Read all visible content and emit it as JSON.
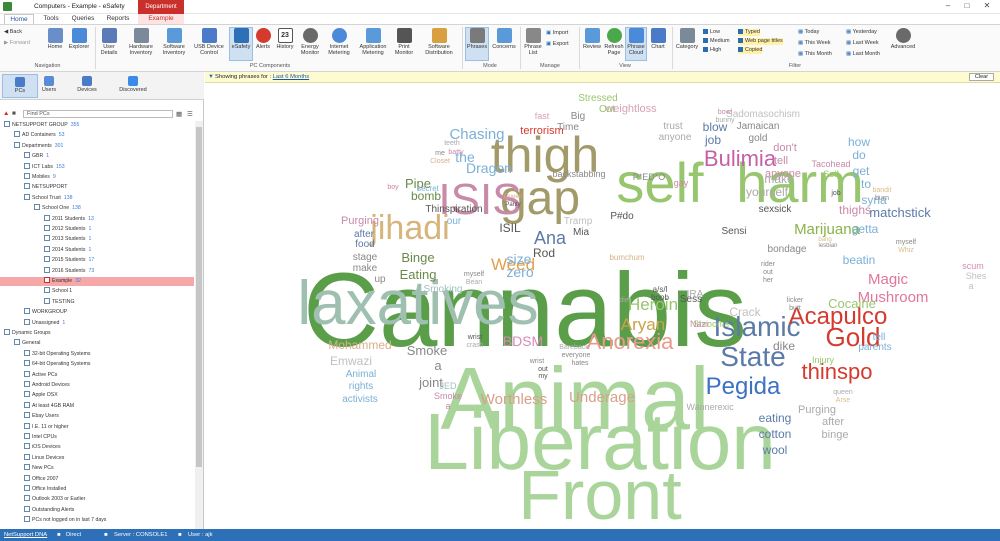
{
  "window": {
    "title": "Computers - Example - eSafety",
    "context_tab": "Department"
  },
  "tabs": [
    "Home",
    "Tools",
    "Queries",
    "Reports",
    "Example"
  ],
  "ribbon": {
    "back": "Back",
    "forward": "Forward",
    "home": "Home",
    "explorer": "Explorer",
    "user_details": "User Details",
    "hardware_inventory": "Hardware Inventory",
    "software_inventory": "Software Inventory",
    "usb_device_control": "USB Device Control",
    "esafety": "eSafety",
    "alerts": "Alerts",
    "history": "History",
    "energy_monitor": "Energy Monitor",
    "internet_metering": "Internet Metering",
    "application_metering": "Application Metering",
    "print_monitor": "Print Monitor",
    "software_distribution": "Software Distribution",
    "phrases": "Phrases",
    "concerns": "Concerns",
    "phrase_list": "Phrase List",
    "import": "Import",
    "export": "Export",
    "review": "Review",
    "refresh_page": "Refresh Page",
    "phrase_cloud": "Phrase Cloud",
    "chart": "Chart",
    "category": "Category",
    "low": "Low",
    "medium": "Medium",
    "high": "High",
    "typed": "Typed",
    "web_page_titles": "Web page titles",
    "copied": "Copied",
    "today": "Today",
    "this_week": "This Week",
    "this_month": "This Month",
    "yesterday": "Yesterday",
    "last_week": "Last Week",
    "last_month": "Last Month",
    "advanced": "Advanced",
    "groups": {
      "navigation": "Navigation",
      "pc_components": "PC Components",
      "mode": "Mode",
      "manage": "Manage",
      "view": "View",
      "filter": "Filter"
    },
    "history_day": "23",
    "colors": {
      "ribbon_selected": "#cfe0f2",
      "accent": "#2e70b8",
      "context": "#c9302c"
    }
  },
  "mode_tabs": [
    "PCs",
    "Users",
    "Devices",
    "Discovered"
  ],
  "search": {
    "placeholder": "Find PCs"
  },
  "tree": [
    {
      "label": "NETSUPPORT GROUP",
      "count": "355",
      "indent": 0
    },
    {
      "label": "AD Containers",
      "count": "53",
      "indent": 1
    },
    {
      "label": "Departments",
      "count": "301",
      "indent": 1
    },
    {
      "label": "GBR",
      "count": "1",
      "indent": 2
    },
    {
      "label": "ICT Labs",
      "count": "153",
      "indent": 2
    },
    {
      "label": "Mobiles",
      "count": "9",
      "indent": 2
    },
    {
      "label": "NETSUPPORT",
      "count": "",
      "indent": 2
    },
    {
      "label": "School Trust",
      "count": "138",
      "indent": 2
    },
    {
      "label": "School One",
      "count": "138",
      "indent": 3
    },
    {
      "label": "2011 Students",
      "count": "13",
      "indent": 4
    },
    {
      "label": "2012 Students",
      "count": "1",
      "indent": 4
    },
    {
      "label": "2013 Students",
      "count": "1",
      "indent": 4
    },
    {
      "label": "2014 Students",
      "count": "1",
      "indent": 4
    },
    {
      "label": "2015 Students",
      "count": "17",
      "indent": 4
    },
    {
      "label": "2016 Students",
      "count": "73",
      "indent": 4
    },
    {
      "label": "Example",
      "count": "32",
      "indent": 4,
      "selected": true
    },
    {
      "label": "School 1",
      "count": "",
      "indent": 4
    },
    {
      "label": "TESTING",
      "count": "",
      "indent": 4
    },
    {
      "label": "WORKGROUP",
      "count": "",
      "indent": 2
    },
    {
      "label": "Unassigned",
      "count": "1",
      "indent": 2
    },
    {
      "label": "Dynamic Groups",
      "count": "",
      "indent": 0
    },
    {
      "label": "General",
      "count": "",
      "indent": 1
    },
    {
      "label": "32-bit Operating Systems",
      "count": "",
      "indent": 2
    },
    {
      "label": "64-bit Operating Systems",
      "count": "",
      "indent": 2
    },
    {
      "label": "Active PCs",
      "count": "",
      "indent": 2
    },
    {
      "label": "Android Devices",
      "count": "",
      "indent": 2
    },
    {
      "label": "Apple OSX",
      "count": "",
      "indent": 2
    },
    {
      "label": "At least 4GB RAM",
      "count": "",
      "indent": 2
    },
    {
      "label": "Ebay Users",
      "count": "",
      "indent": 2
    },
    {
      "label": "I.E. 11 or higher",
      "count": "",
      "indent": 2
    },
    {
      "label": "Intel CPUs",
      "count": "",
      "indent": 2
    },
    {
      "label": "iOS Devices",
      "count": "",
      "indent": 2
    },
    {
      "label": "Linux Devices",
      "count": "",
      "indent": 2
    },
    {
      "label": "New PCs",
      "count": "",
      "indent": 2
    },
    {
      "label": "Office 2007",
      "count": "",
      "indent": 2
    },
    {
      "label": "Office Installed",
      "count": "",
      "indent": 2
    },
    {
      "label": "Outlook 2003 or Earlier",
      "count": "",
      "indent": 2
    },
    {
      "label": "Outstanding Alerts",
      "count": "",
      "indent": 2
    },
    {
      "label": "PCs not logged on in last 7 days",
      "count": "",
      "indent": 2
    }
  ],
  "filterbar": {
    "prefix": "Showing phrases for :",
    "period": "Last 6 Months",
    "clear": "Clear"
  },
  "cloud": [
    {
      "t": "Cannabis",
      "c": "#5a9e4a"
    },
    {
      "t": "Animal",
      "c": "#a9d49a"
    },
    {
      "t": "Liberation",
      "c": "#a9d49a"
    },
    {
      "t": "Front",
      "c": "#a9d49a"
    },
    {
      "t": "laxatives",
      "c": "#9fc0b0"
    },
    {
      "t": "self",
      "c": "#98c66e"
    },
    {
      "t": "harm",
      "c": "#98c66e"
    },
    {
      "t": "thigh",
      "c": "#a39a6a"
    },
    {
      "t": "gap",
      "c": "#a39a6a"
    },
    {
      "t": "ISIS",
      "c": "#c88aa8"
    },
    {
      "t": "jihadi",
      "c": "#d7b47a"
    },
    {
      "t": "Bulimia",
      "c": "#c55fa8"
    },
    {
      "t": "Islamic",
      "c": "#5c7aa8"
    },
    {
      "t": "State",
      "c": "#5c7aa8"
    },
    {
      "t": "Acapulco",
      "c": "#d53a2e"
    },
    {
      "t": "Gold",
      "c": "#d53a2e"
    },
    {
      "t": "Pegida",
      "c": "#3c72c4"
    },
    {
      "t": "thinspo",
      "c": "#d53a2e"
    },
    {
      "t": "Anorexia",
      "c": "#e89a8a"
    },
    {
      "t": "Mushroom",
      "c": "#e0769a"
    },
    {
      "t": "Magic",
      "c": "#e0769a"
    },
    {
      "t": "Marijuana",
      "c": "#88b24a"
    },
    {
      "t": "Weed",
      "c": "#e0a050"
    },
    {
      "t": "Heroin",
      "c": "#98c66e"
    },
    {
      "t": "Aryan",
      "c": "#c9a24a"
    },
    {
      "t": "Worthless",
      "c": "#d8a088"
    },
    {
      "t": "Underage",
      "c": "#d8a088"
    },
    {
      "t": "Chasing",
      "c": "#7ab0d8"
    },
    {
      "t": "the",
      "c": "#7ab0d8"
    },
    {
      "t": "Dragon",
      "c": "#7ab0d8"
    },
    {
      "t": "Pipe",
      "c": "#6a8a4a"
    },
    {
      "t": "bomb",
      "c": "#6a8a4a"
    },
    {
      "t": "Binge",
      "c": "#6a8a4a"
    },
    {
      "t": "Eating",
      "c": "#6a8a4a"
    },
    {
      "t": "Mohammed",
      "c": "#d8b088"
    },
    {
      "t": "Emwazi",
      "c": "#c0c0c0"
    },
    {
      "t": "Smoke",
      "c": "#888"
    },
    {
      "t": "a",
      "c": "#888"
    },
    {
      "t": "joint",
      "c": "#888"
    },
    {
      "t": "BDSM",
      "c": "#d88ab8"
    },
    {
      "t": "Cocaine",
      "c": "#98c66e"
    },
    {
      "t": "Crack",
      "c": "#c0c0c0"
    },
    {
      "t": "dike",
      "c": "#888"
    },
    {
      "t": "matchstick",
      "c": "#5c7aa8"
    },
    {
      "t": "thighs",
      "c": "#c88aa8"
    },
    {
      "t": "getta",
      "c": "#7ab0d8"
    },
    {
      "t": "beatin",
      "c": "#7ab0d8"
    },
    {
      "t": "eating",
      "c": "#5c7aa8"
    },
    {
      "t": "cotton",
      "c": "#5c7aa8"
    },
    {
      "t": "wool",
      "c": "#5c7aa8"
    },
    {
      "t": "Purging",
      "c": "#aaa"
    },
    {
      "t": "after",
      "c": "#aaa"
    },
    {
      "t": "binge",
      "c": "#aaa"
    },
    {
      "t": "Purging",
      "c": "#c88aa8"
    },
    {
      "t": "after",
      "c": "#5c7aa8"
    },
    {
      "t": "food",
      "c": "#5c7aa8"
    },
    {
      "t": "stage",
      "c": "#888"
    },
    {
      "t": "make",
      "c": "#888"
    },
    {
      "t": "up",
      "c": "#888"
    },
    {
      "t": "Animal",
      "c": "#7ab0d8"
    },
    {
      "t": "rights",
      "c": "#7ab0d8"
    },
    {
      "t": "activists",
      "c": "#7ab0d8"
    },
    {
      "t": "Smoking",
      "c": "#a0c0c0"
    },
    {
      "t": "Ana",
      "c": "#5c7aa8"
    },
    {
      "t": "size",
      "c": "#7ab0d8"
    },
    {
      "t": "zero",
      "c": "#7ab0d8"
    },
    {
      "t": "Rod",
      "c": "#555"
    },
    {
      "t": "ISIL",
      "c": "#555"
    },
    {
      "t": "terrorism",
      "c": "#d53a2e"
    },
    {
      "t": "weightloss",
      "c": "#d8a0b8"
    },
    {
      "t": "yourself",
      "c": "#aaa"
    },
    {
      "t": "make",
      "c": "#aaa"
    },
    {
      "t": "sexsick",
      "c": "#555"
    },
    {
      "t": "bondage",
      "c": "#888"
    },
    {
      "t": "parents",
      "c": "#7ab0d8"
    },
    {
      "t": "tell",
      "c": "#7ab0d8"
    },
    {
      "t": "how",
      "c": "#7ab0d8"
    },
    {
      "t": "do",
      "c": "#7ab0d8"
    },
    {
      "t": "get",
      "c": "#7ab0d8"
    },
    {
      "t": "to",
      "c": "#7ab0d8"
    },
    {
      "t": "syria",
      "c": "#7ab0d8"
    },
    {
      "t": "don't",
      "c": "#c88aa8"
    },
    {
      "t": "tell",
      "c": "#c88aa8"
    },
    {
      "t": "anyone",
      "c": "#c88aa8"
    },
    {
      "t": "Sadomasochism",
      "c": "#c0c0c0"
    },
    {
      "t": "Jamaican",
      "c": "#888"
    },
    {
      "t": "gold",
      "c": "#888"
    },
    {
      "t": "blow",
      "c": "#5c7aa8"
    },
    {
      "t": "job",
      "c": "#5c7aa8"
    },
    {
      "t": "trust",
      "c": "#aaa"
    },
    {
      "t": "anyone",
      "c": "#aaa"
    },
    {
      "t": "Stressed",
      "c": "#98c66e"
    },
    {
      "t": "Out",
      "c": "#98c66e"
    },
    {
      "t": "Big",
      "c": "#888"
    },
    {
      "t": "Time",
      "c": "#888"
    },
    {
      "t": "fast",
      "c": "#d8a0b8"
    },
    {
      "t": "backstabbing",
      "c": "#888"
    },
    {
      "t": "P*ED*O",
      "c": "#888"
    },
    {
      "t": "gay",
      "c": "#c88aa8"
    },
    {
      "t": "Thinspiration",
      "c": "#555"
    },
    {
      "t": "our",
      "c": "#7ab0d8"
    },
    {
      "t": "secret",
      "c": "#7ab0d8"
    },
    {
      "t": "Wannerexic",
      "c": "#aaa"
    },
    {
      "t": "Tacohead",
      "c": "#c88aa8"
    },
    {
      "t": "Self",
      "c": "#98c66e"
    },
    {
      "t": "Injury",
      "c": "#98c66e"
    },
    {
      "t": "Shrooms",
      "c": "#98c66e"
    },
    {
      "t": "Nazi",
      "c": "#c88aa8"
    },
    {
      "t": "Sess",
      "c": "#555"
    },
    {
      "t": "IRA",
      "c": "#aaa"
    },
    {
      "t": "scum",
      "c": "#d88ab8"
    },
    {
      "t": "Shes",
      "c": "#c0c0c0"
    },
    {
      "t": "a",
      "c": "#c0c0c0"
    },
    {
      "t": "Tramp",
      "c": "#c0c0c0"
    },
    {
      "t": "Mia",
      "c": "#555"
    },
    {
      "t": "Sensi",
      "c": "#555"
    },
    {
      "t": "P#do",
      "c": "#555"
    },
    {
      "t": "JED",
      "c": "#a0c0c0"
    },
    {
      "t": "Smoke",
      "c": "#c88aa8"
    },
    {
      "t": "a",
      "c": "#c88aa8"
    },
    {
      "t": "bowl",
      "c": "#c88aa8"
    },
    {
      "t": "bunny",
      "c": "#aaa"
    },
    {
      "t": "teeth",
      "c": "#aaa"
    },
    {
      "t": "batty",
      "c": "#c88aa8"
    },
    {
      "t": "boy",
      "c": "#c88aa8"
    },
    {
      "t": "bumchum",
      "c": "#d8b088"
    },
    {
      "t": "a/s/l",
      "c": "#555"
    },
    {
      "t": "boob",
      "c": "#555"
    },
    {
      "t": "job",
      "c": "#555"
    },
    {
      "t": "myself",
      "c": "#888"
    },
    {
      "t": "Bean",
      "c": "#aaa"
    },
    {
      "t": "queen",
      "c": "#aaa"
    },
    {
      "t": "Arse",
      "c": "#d8c088"
    },
    {
      "t": "bandit",
      "c": "#d8c088"
    },
    {
      "t": "burn",
      "c": "#888"
    },
    {
      "t": "myself",
      "c": "#888"
    },
    {
      "t": "Whiz",
      "c": "#d8c088"
    },
    {
      "t": "bang",
      "c": "#d8c088"
    },
    {
      "t": "lesbian",
      "c": "#888"
    },
    {
      "t": "licker",
      "c": "#888"
    },
    {
      "t": "butt",
      "c": "#888"
    },
    {
      "t": "rider",
      "c": "#888"
    },
    {
      "t": "out",
      "c": "#888"
    },
    {
      "t": "her",
      "c": "#888"
    },
    {
      "t": "wrist",
      "c": "#888"
    },
    {
      "t": "out",
      "c": "#555"
    },
    {
      "t": "my",
      "c": "#555"
    },
    {
      "t": "wrist",
      "c": "#555"
    },
    {
      "t": "crash",
      "c": "#aaa"
    },
    {
      "t": "diet",
      "c": "#aaa"
    },
    {
      "t": "Bareback",
      "c": "#aaa"
    },
    {
      "t": "everyone",
      "c": "#888"
    },
    {
      "t": "hates",
      "c": "#888"
    },
    {
      "t": "me",
      "c": "#888"
    },
    {
      "t": "Closet",
      "c": "#d8b088"
    },
    {
      "t": "Queen",
      "c": "#d8b088"
    },
    {
      "t": "Panty",
      "c": "#555"
    },
    {
      "t": "Basher",
      "c": "#555"
    }
  ],
  "status": {
    "product": "NetSupport DNA",
    "mode": "Direct",
    "server": "Server : CONSOLE1",
    "user": "User : ajk"
  }
}
